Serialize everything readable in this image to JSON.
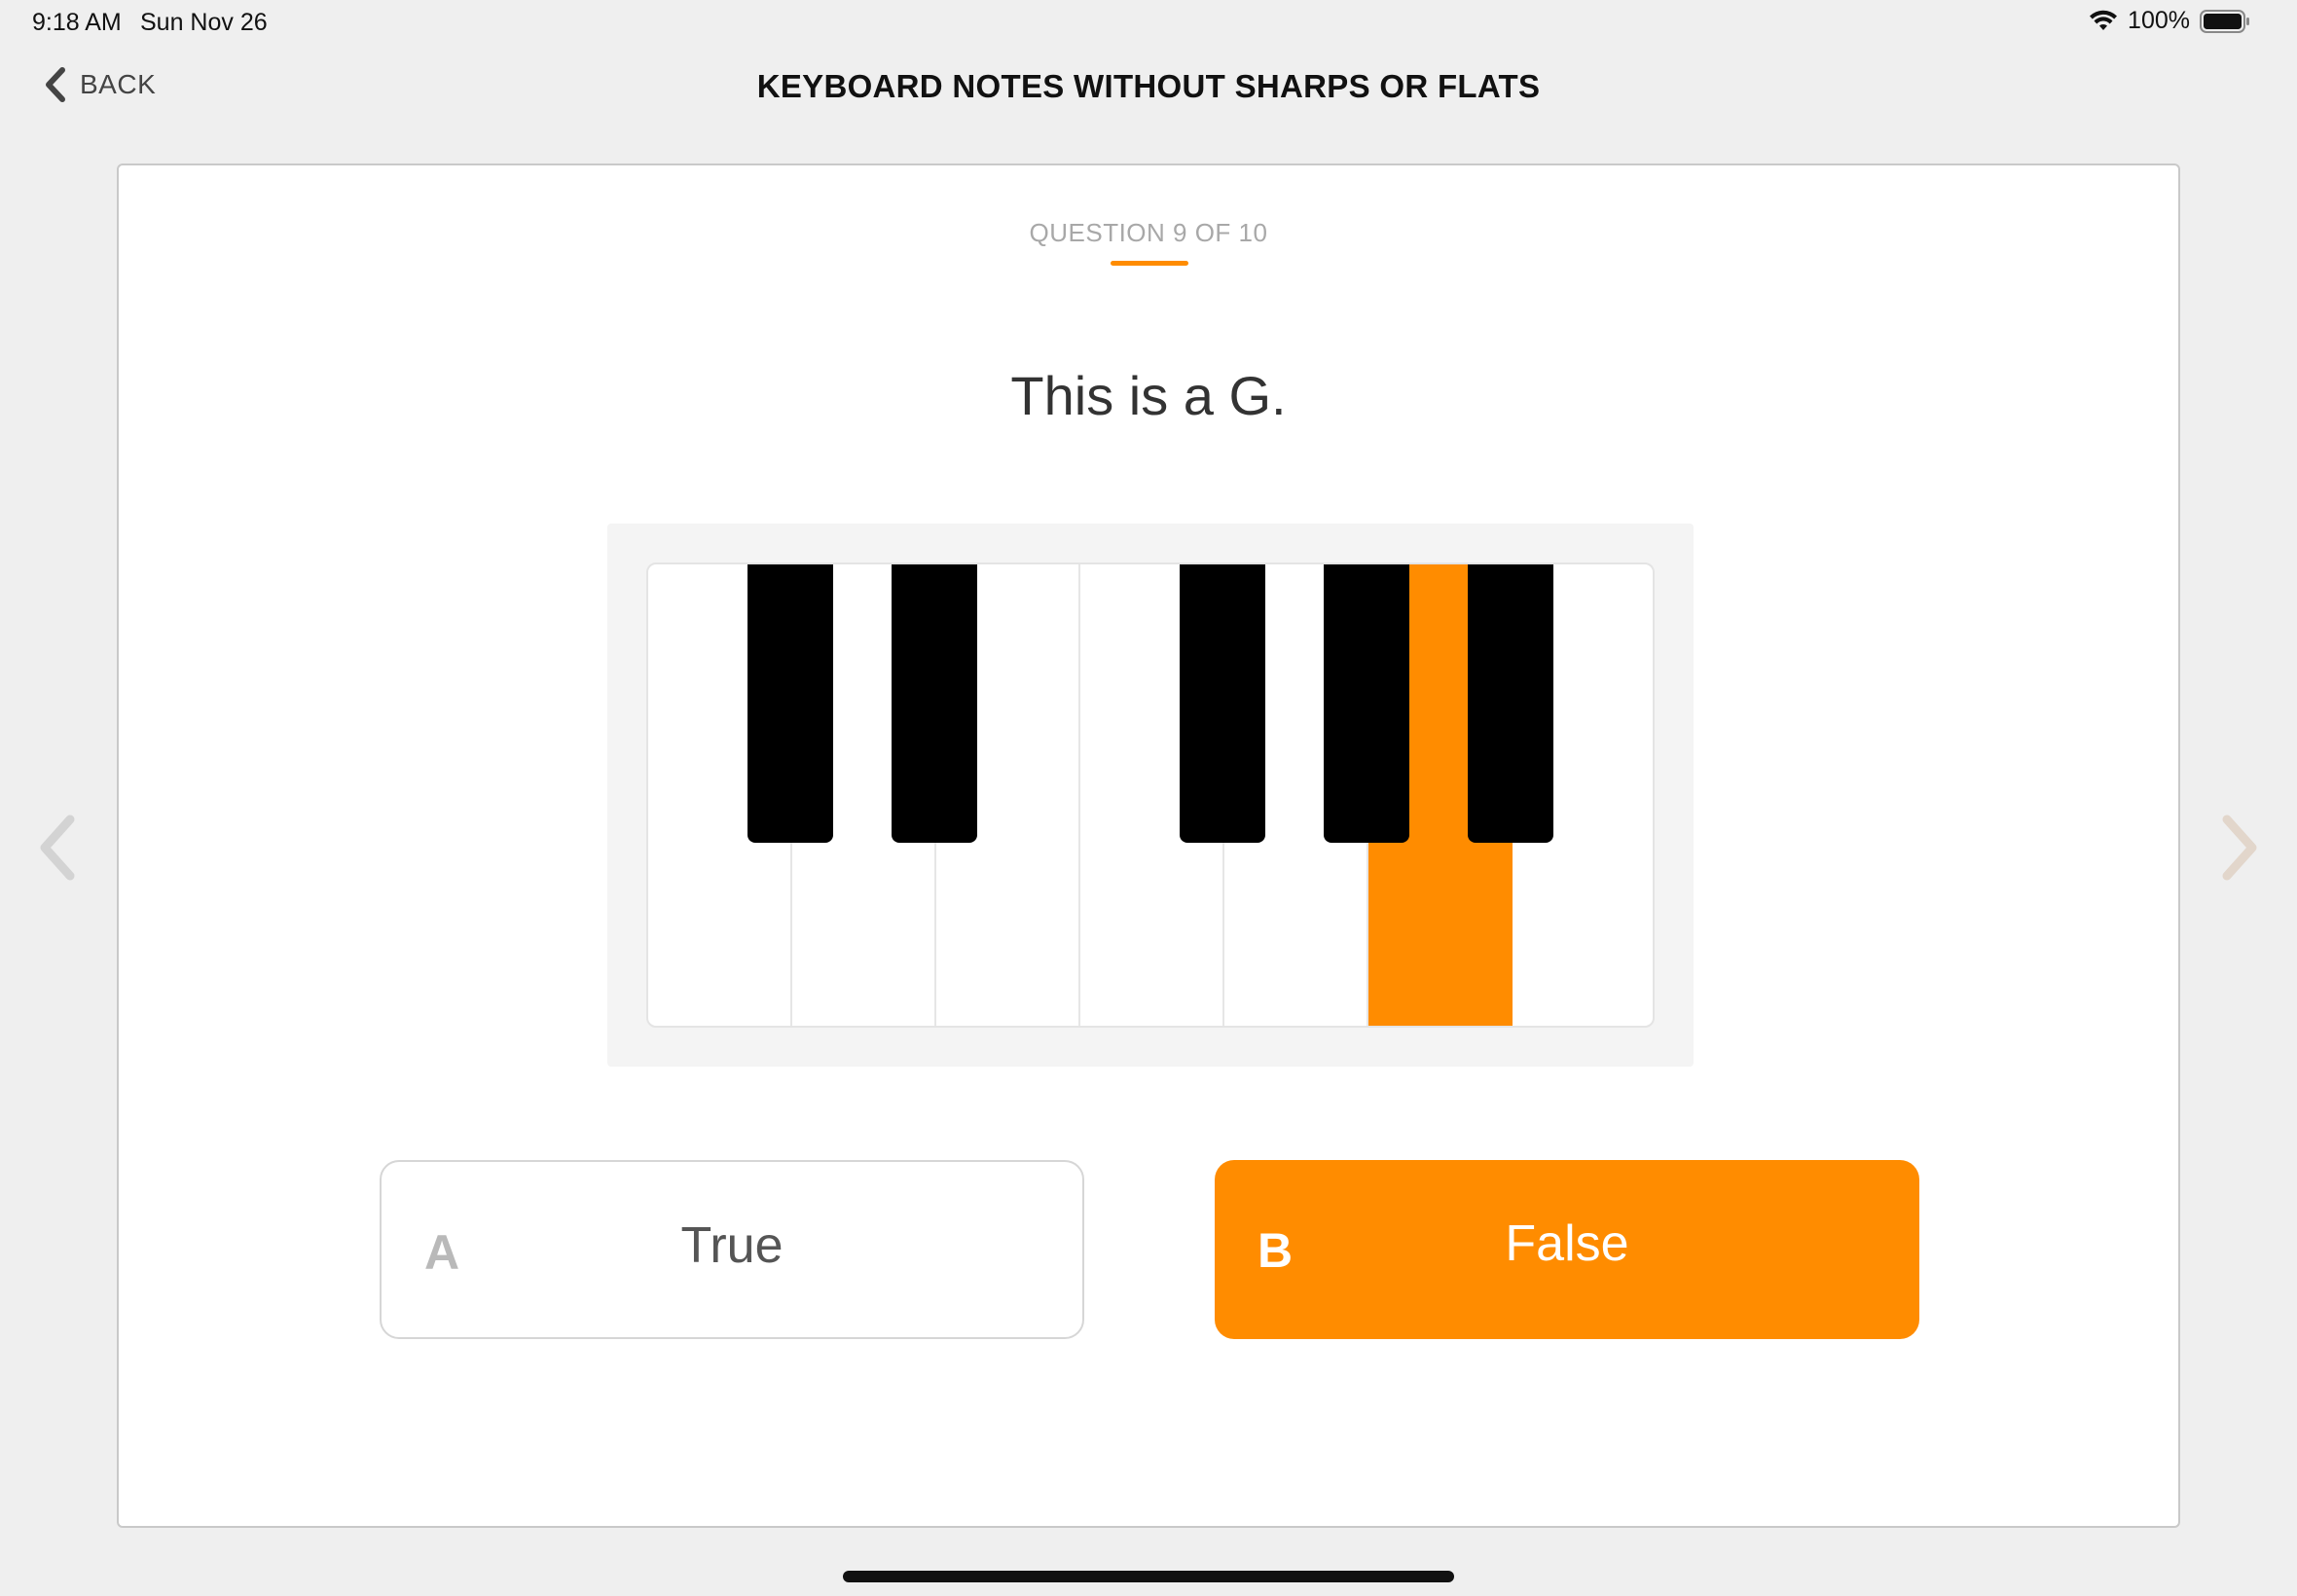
{
  "status_bar": {
    "time": "9:18 AM",
    "date": "Sun Nov 26",
    "battery": "100%",
    "wifi_icon": "wifi-icon",
    "battery_icon": "battery-icon"
  },
  "nav": {
    "back_label": "BACK",
    "back_icon": "chevron-left-icon",
    "title": "KEYBOARD NOTES WITHOUT SHARPS OR FLATS"
  },
  "quiz": {
    "counter": "QUESTION 9 OF 10",
    "question": "This is a G.",
    "keyboard": {
      "white_keys": 7,
      "highlighted_white_key": 6,
      "accent_color": "#ff8c00"
    },
    "answers": [
      {
        "letter": "A",
        "text": "True",
        "selected": false
      },
      {
        "letter": "B",
        "text": "False",
        "selected": true
      }
    ]
  },
  "colors": {
    "accent": "#ff8c00",
    "background": "#efefef",
    "card": "#ffffff"
  }
}
